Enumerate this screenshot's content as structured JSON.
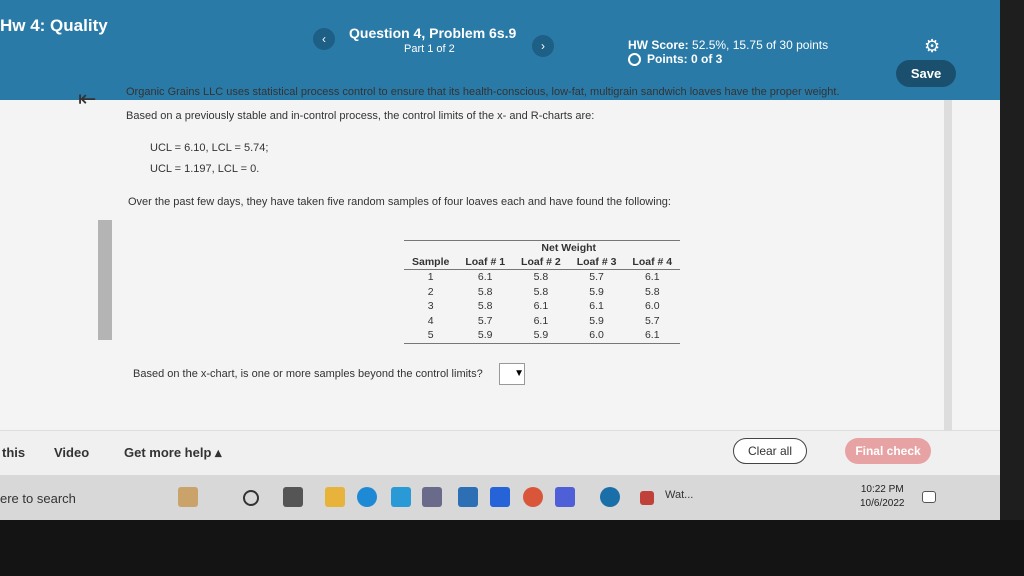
{
  "header": {
    "course_title": "Hw 4: Quality",
    "prev_glyph": "‹",
    "next_glyph": "›",
    "question_title": "Question 4, Problem 6s.9",
    "part": "Part 1 of 2",
    "hw_score_label": "HW Score:",
    "hw_score_value": "52.5%, 15.75 of 30 points",
    "points": "Points: 0 of 3",
    "save_label": "Save",
    "gear_icon": "gear-icon",
    "colors": {
      "bar": "#2a7aa8",
      "save": "#1a4f6e"
    }
  },
  "problem": {
    "line1": "Organic Grains LLC uses statistical process control to ensure that its health-conscious, low-fat, multigrain sandwich loaves have the proper weight.",
    "line2": "Based on a previously stable and in-control process, the control limits of the x- and R-charts are:",
    "limits_x": "UCL  = 6.10, LCL  = 5.74;",
    "limits_r": "UCL  = 1.197, LCL  = 0.",
    "line3": "Over the past few days, they have taken five random samples of four loaves each and have found the following:",
    "question": "Based on the x-chart, is one or more samples beyond the control limits?"
  },
  "table": {
    "group_header": "Net Weight",
    "headers": [
      "Sample",
      "Loaf # 1",
      "Loaf # 2",
      "Loaf # 3",
      "Loaf # 4"
    ],
    "rows": [
      [
        "1",
        "6.1",
        "5.8",
        "5.7",
        "6.1"
      ],
      [
        "2",
        "5.8",
        "5.8",
        "5.9",
        "5.8"
      ],
      [
        "3",
        "5.8",
        "6.1",
        "6.1",
        "6.0"
      ],
      [
        "4",
        "5.7",
        "6.1",
        "5.9",
        "5.7"
      ],
      [
        "5",
        "5.9",
        "5.9",
        "6.0",
        "6.1"
      ]
    ]
  },
  "bottom": {
    "this": "this",
    "video": "Video",
    "help": "Get more help ▴",
    "clear": "Clear all",
    "final": "Final check"
  },
  "taskbar": {
    "search": "ere to search",
    "app_label": "Wat...",
    "time": "10:22 PM",
    "date": "10/6/2022"
  }
}
